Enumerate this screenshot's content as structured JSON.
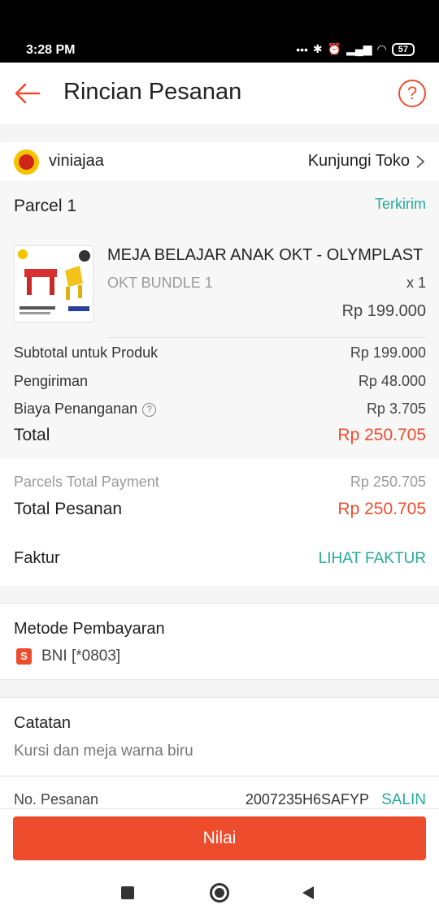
{
  "status_bar": {
    "time": "3:28 PM",
    "battery": "57"
  },
  "header": {
    "title": "Rincian Pesanan"
  },
  "shop": {
    "name": "viniajaa",
    "visit_label": "Kunjungi Toko"
  },
  "parcel": {
    "title": "Parcel 1",
    "status": "Terkirim",
    "product": {
      "name": "MEJA BELAJAR ANAK OKT - OLYMPLAST",
      "variant": "OKT BUNDLE 1",
      "qty": "x 1",
      "price": "Rp 199.000"
    },
    "rows": [
      {
        "label": "Subtotal untuk Produk",
        "value": "Rp 199.000"
      },
      {
        "label": "Pengiriman",
        "value": "Rp 48.000"
      },
      {
        "label": "Biaya Penanganan",
        "value": "Rp 3.705"
      }
    ],
    "total_label": "Total",
    "total_value": "Rp 250.705"
  },
  "summary": {
    "parcels_total_label": "Parcels Total Payment",
    "parcels_total_value": "Rp 250.705",
    "order_total_label": "Total Pesanan",
    "order_total_value": "Rp 250.705",
    "invoice_label": "Faktur",
    "invoice_link": "LIHAT FAKTUR"
  },
  "payment": {
    "title": "Metode Pembayaran",
    "method": "BNI [*0803]"
  },
  "notes": {
    "title": "Catatan",
    "text": "Kursi dan meja warna biru"
  },
  "order": {
    "label": "No. Pesanan",
    "number": "2007235H6SAFYP",
    "copy_label": "SALIN"
  },
  "action": {
    "rate_label": "Nilai"
  },
  "colors": {
    "accent": "#ee4d2d",
    "teal": "#26aa99"
  }
}
